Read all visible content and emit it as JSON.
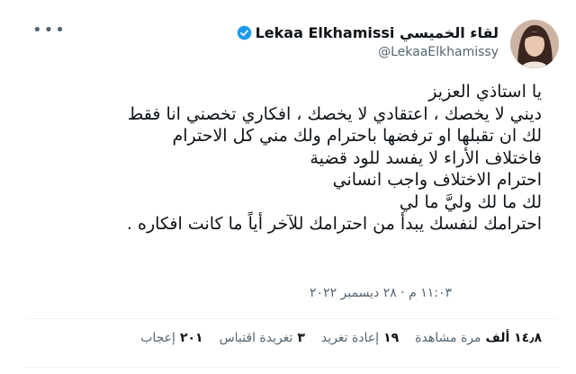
{
  "user": {
    "display_name": "Lekaa Elkhamissi لقاء الخميسي",
    "handle": "@LekaaElkhamissy",
    "verified": true
  },
  "tweet": {
    "lines": [
      "يا استاذي العزيز",
      "ديني لا يخصك ، اعتقادي لا يخصك ، افكاري تخصني انا فقط",
      "لك ان تقبلها او ترفضها باحترام ولك مني كل الاحترام",
      "فاختلاف الأراء لا يفسد للود قضية",
      "احترام الاختلاف واجب انساني",
      "لك ما لك وليَّ ما لي",
      "احترامك لنفسك يبدأ من احترامك للآخر أياً ما كانت افكاره ."
    ],
    "timestamp": "١١:٠٣ م · ٢٨ ديسمبر ٢٠٢٢"
  },
  "stats": {
    "views_count": "١٤٫٨ ألف",
    "views_label": "مرة مشاهدة",
    "retweets_count": "١٩",
    "retweets_label": "إعادة تغريد",
    "quotes_count": "٣",
    "quotes_label": "تغريدة اقتباس",
    "likes_count": "٢٠١",
    "likes_label": "إعجاب"
  },
  "colors": {
    "verified_badge": "#1d9bf0",
    "secondary_text": "#536471",
    "primary_text": "#0f1419"
  }
}
